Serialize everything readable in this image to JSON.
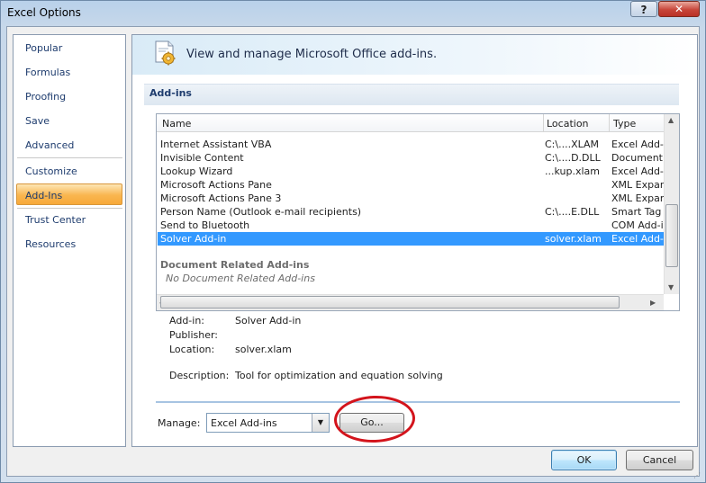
{
  "window": {
    "title": "Excel Options",
    "help_label": "?",
    "close_label": "✕"
  },
  "sidebar": {
    "items": [
      {
        "label": "Popular"
      },
      {
        "label": "Formulas"
      },
      {
        "label": "Proofing"
      },
      {
        "label": "Save"
      },
      {
        "label": "Advanced"
      },
      {
        "label": "Customize"
      },
      {
        "label": "Add-Ins",
        "selected": true
      },
      {
        "label": "Trust Center"
      },
      {
        "label": "Resources"
      }
    ]
  },
  "header": {
    "text": "View and manage Microsoft Office add-ins.",
    "icon": "gear-document-icon"
  },
  "section": {
    "title": "Add-ins"
  },
  "list": {
    "columns": [
      "Name",
      "Location",
      "Type"
    ],
    "rows": [
      {
        "name": "Internet Assistant VBA",
        "location": "C:\\....XLAM",
        "type": "Excel Add-in"
      },
      {
        "name": "Invisible Content",
        "location": "C:\\....D.DLL",
        "type": "Document Inspector"
      },
      {
        "name": "Lookup Wizard",
        "location": "...kup.xlam",
        "type": "Excel Add-in"
      },
      {
        "name": "Microsoft Actions Pane",
        "location": "",
        "type": "XML Expansion Pack"
      },
      {
        "name": "Microsoft Actions Pane 3",
        "location": "",
        "type": "XML Expansion Pack"
      },
      {
        "name": "Person Name (Outlook e-mail recipients)",
        "location": "C:\\....E.DLL",
        "type": "Smart Tag"
      },
      {
        "name": "Send to Bluetooth",
        "location": "",
        "type": "COM Add-in"
      },
      {
        "name": "Solver Add-in",
        "location": "solver.xlam",
        "type": "Excel Add-in",
        "selected": true
      }
    ],
    "group_title": "Document Related Add-ins",
    "group_empty": "No Document Related Add-ins"
  },
  "details": {
    "addin_label": "Add-in:",
    "addin_value": "Solver Add-in",
    "publisher_label": "Publisher:",
    "publisher_value": "",
    "location_label": "Location:",
    "location_value": "solver.xlam",
    "description_label": "Description:",
    "description_value": "Tool for optimization and equation solving"
  },
  "manage": {
    "label": "Manage:",
    "selected": "Excel Add-ins",
    "go_label": "Go..."
  },
  "footer": {
    "ok_label": "OK",
    "cancel_label": "Cancel"
  },
  "colors": {
    "selection": "#3399ff",
    "highlight_circle": "#d3141c",
    "active_nav": "#f9b64f"
  }
}
